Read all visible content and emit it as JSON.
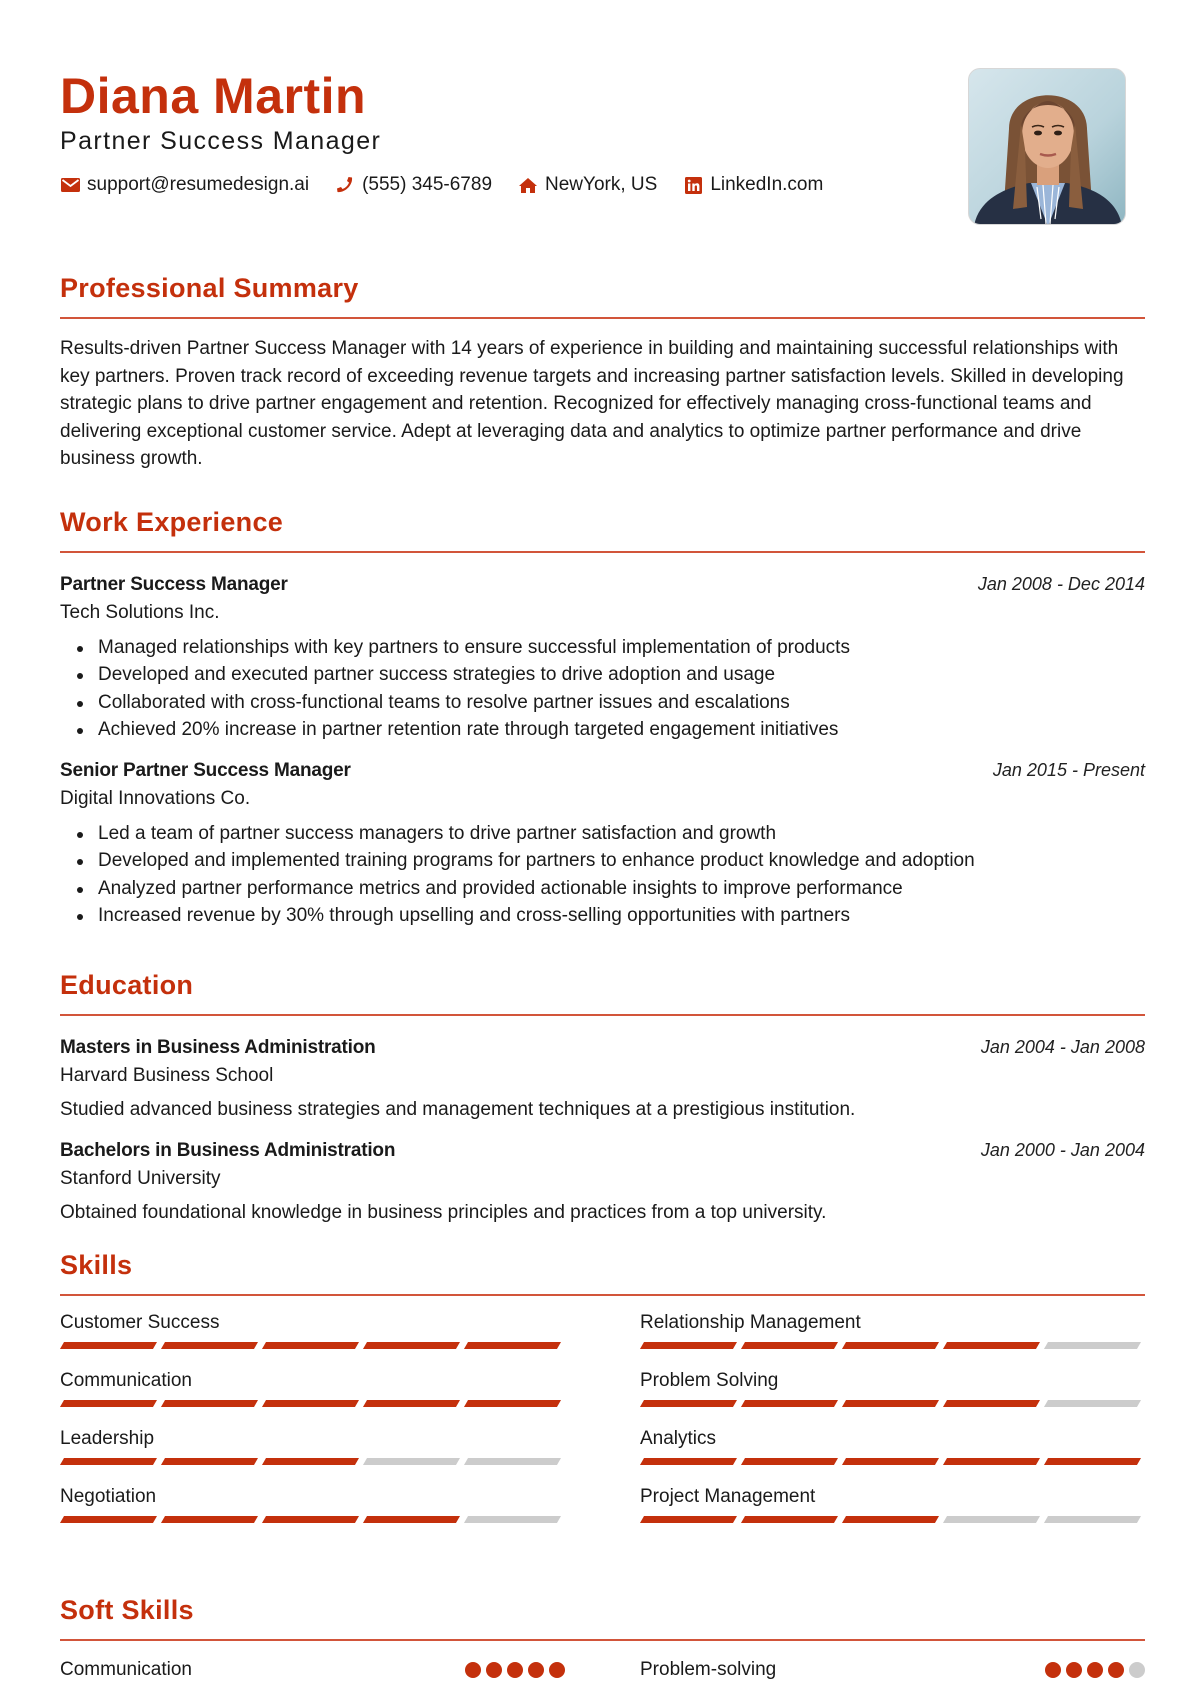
{
  "header": {
    "name": "Diana Martin",
    "title": "Partner Success Manager",
    "contacts": [
      {
        "icon": "envelope-icon",
        "text": "support@resumedesign.ai"
      },
      {
        "icon": "phone-icon",
        "text": "(555) 345-6789"
      },
      {
        "icon": "home-icon",
        "text": "NewYork, US"
      },
      {
        "icon": "linkedin-icon",
        "text": "LinkedIn.com"
      }
    ],
    "photo_alt": "Profile photo"
  },
  "colors": {
    "accent": "#c4300c",
    "rule": "#d2553a",
    "inactive": "#cccccc",
    "text": "#1a1a1a"
  },
  "summary": {
    "heading": "Professional Summary",
    "text": "Results-driven Partner Success Manager with 14 years of experience in building and maintaining successful relationships with key partners. Proven track record of exceeding revenue targets and increasing partner satisfaction levels. Skilled in developing strategic plans to drive partner engagement and retention. Recognized for effectively managing cross-functional teams and delivering exceptional customer service. Adept at leveraging data and analytics to optimize partner performance and drive business growth."
  },
  "experience": {
    "heading": "Work Experience",
    "jobs": [
      {
        "title": "Partner Success Manager",
        "company": "Tech Solutions Inc.",
        "dates": "Jan 2008 - Dec 2014",
        "bullets": [
          "Managed relationships with key partners to ensure successful implementation of products",
          "Developed and executed partner success strategies to drive adoption and usage",
          "Collaborated with cross-functional teams to resolve partner issues and escalations",
          "Achieved 20% increase in partner retention rate through targeted engagement initiatives"
        ]
      },
      {
        "title": "Senior Partner Success Manager",
        "company": "Digital Innovations Co.",
        "dates": "Jan 2015 - Present",
        "bullets": [
          "Led a team of partner success managers to drive partner satisfaction and growth",
          "Developed and implemented training programs for partners to enhance product knowledge and adoption",
          "Analyzed partner performance metrics and provided actionable insights to improve performance",
          "Increased revenue by 30% through upselling and cross-selling opportunities with partners"
        ]
      }
    ]
  },
  "education": {
    "heading": "Education",
    "items": [
      {
        "degree": "Masters in Business Administration",
        "school": "Harvard Business School",
        "dates": "Jan 2004 - Jan 2008",
        "description": "Studied advanced business strategies and management techniques at a prestigious institution."
      },
      {
        "degree": "Bachelors in Business Administration",
        "school": "Stanford University",
        "dates": "Jan 2000 - Jan 2004",
        "description": "Obtained foundational knowledge in business principles and practices from a top university."
      }
    ]
  },
  "skills": {
    "heading": "Skills",
    "max": 5,
    "items": [
      {
        "name": "Customer Success",
        "level": 5
      },
      {
        "name": "Relationship Management",
        "level": 4
      },
      {
        "name": "Communication",
        "level": 5
      },
      {
        "name": "Problem Solving",
        "level": 4
      },
      {
        "name": "Leadership",
        "level": 3
      },
      {
        "name": "Analytics",
        "level": 5
      },
      {
        "name": "Negotiation",
        "level": 4
      },
      {
        "name": "Project Management",
        "level": 3
      }
    ]
  },
  "soft_skills": {
    "heading": "Soft Skills",
    "max": 5,
    "items": [
      {
        "name": "Communication",
        "level": 5
      },
      {
        "name": "Problem-solving",
        "level": 4
      }
    ]
  }
}
